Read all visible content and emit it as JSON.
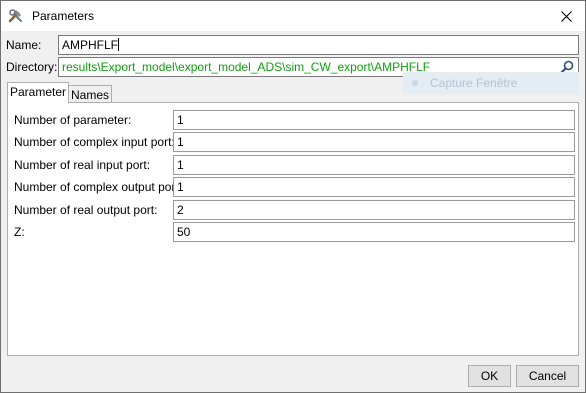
{
  "window": {
    "title": "Parameters"
  },
  "form": {
    "name_label": "Name:",
    "name_value": "AMPHFLF",
    "directory_label": "Directory:",
    "directory_value": "results\\Export_model\\export_model_ADS\\sim_CW_export\\AMPHFLF"
  },
  "overlay": {
    "capture_text": "Capture Fenêtre"
  },
  "tabs": [
    {
      "label": "Parameter",
      "active": true
    },
    {
      "label": "Names",
      "active": false
    }
  ],
  "parameters": [
    {
      "label": "Number of parameter:",
      "value": "1"
    },
    {
      "label": "Number of complex input port:",
      "value": "1"
    },
    {
      "label": "Number of real input port:",
      "value": "1"
    },
    {
      "label": "Number of complex output port:",
      "value": "1"
    },
    {
      "label": "Number of real output port:",
      "value": "2"
    },
    {
      "label": "Z:",
      "value": "50"
    }
  ],
  "buttons": {
    "ok": "OK",
    "cancel": "Cancel"
  },
  "colors": {
    "directory_text": "#10a010",
    "title_bg": "#ffffff",
    "dialog_bg": "#f0f0f0"
  },
  "icons": {
    "app": "tools-icon",
    "close": "close-icon",
    "search": "search-icon"
  }
}
